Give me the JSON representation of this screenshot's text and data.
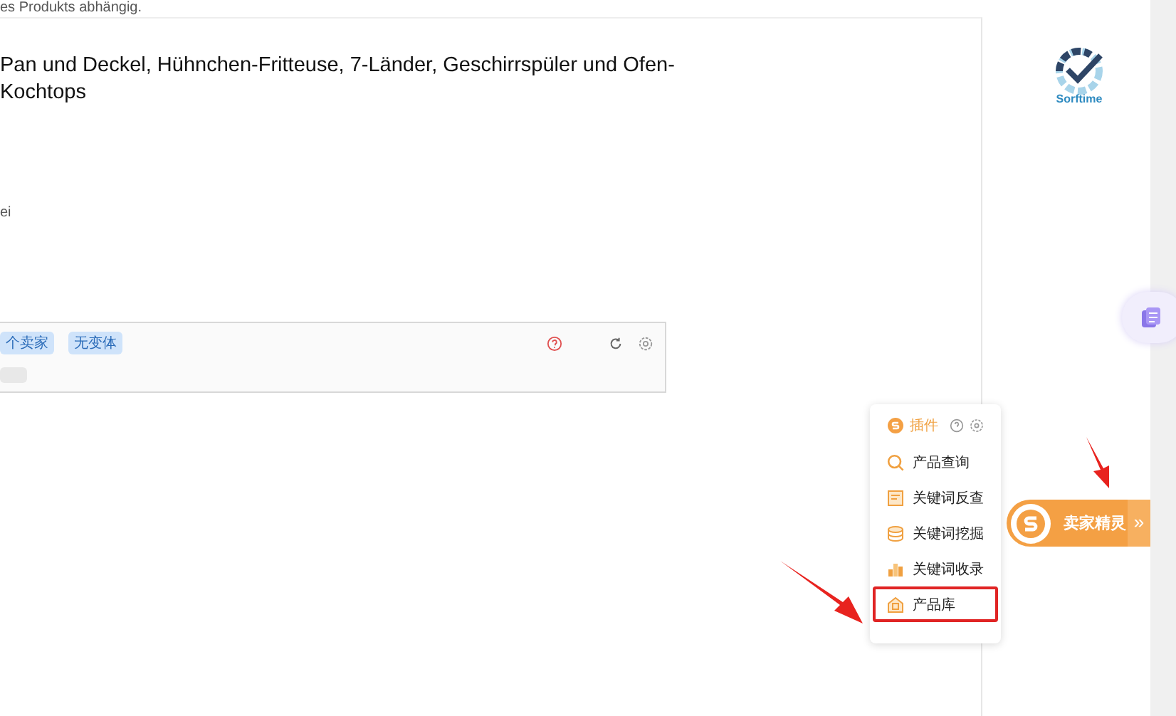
{
  "note": "es Produkts abhängig.",
  "product": {
    "title": "Pan und Deckel, Hühnchen-Fritteuse, 7-Länder, Geschirrspüler und Ofen-Kochtops",
    "detail": "ei"
  },
  "plugin_bar": {
    "tags": [
      "个卖家",
      "无变体"
    ]
  },
  "logo": {
    "text": "Sorftime"
  },
  "plugin_menu": {
    "title": "插件",
    "items": [
      {
        "label": "产品查询",
        "kind": "search",
        "selected": false
      },
      {
        "label": "关键词反查",
        "kind": "doc",
        "selected": false
      },
      {
        "label": "关键词挖掘",
        "kind": "stack",
        "selected": false
      },
      {
        "label": "关键词收录",
        "kind": "chart",
        "selected": false
      },
      {
        "label": "产品库",
        "kind": "store",
        "selected": true
      }
    ]
  },
  "seller_button": {
    "label": "卖家精灵",
    "expand": "»"
  }
}
